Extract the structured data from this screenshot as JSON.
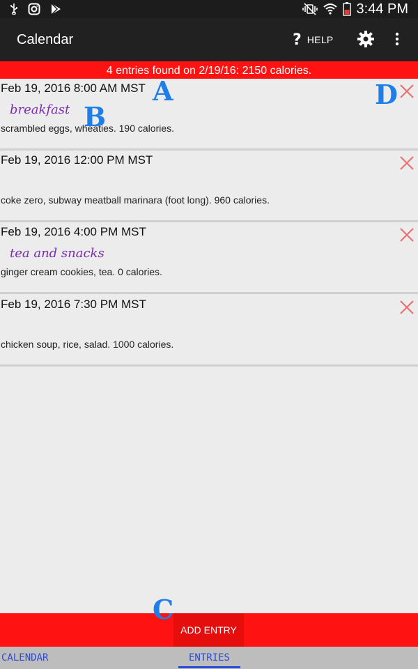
{
  "status_bar": {
    "time": "3:44 PM",
    "icons_left": [
      "usb-icon",
      "instagram-icon",
      "play-store-icon"
    ],
    "icons_right": [
      "vibrate-mute-icon",
      "wifi-icon",
      "battery-icon"
    ]
  },
  "app_bar": {
    "title": "Calendar",
    "help_label": "HELP",
    "help_glyph": "?",
    "icons": [
      "help-icon",
      "settings-gear-icon",
      "overflow-menu-icon"
    ]
  },
  "summary": "4 entries found on 2/19/16: 2150 calories.",
  "entries": [
    {
      "date": "Feb 19, 2016 8:00 AM MST",
      "title": "breakfast",
      "desc": "scrambled eggs, wheaties.  190 calories."
    },
    {
      "date": "Feb 19, 2016 12:00 PM MST",
      "title": "",
      "desc": "coke zero, subway meatball marinara (foot long).  960 calories."
    },
    {
      "date": "Feb 19, 2016 4:00 PM MST",
      "title": "tea and snacks",
      "desc": "ginger cream cookies, tea.  0 calories."
    },
    {
      "date": "Feb 19, 2016 7:30 PM MST",
      "title": "",
      "desc": "chicken soup, rice, salad.  1000 calories."
    }
  ],
  "markers": {
    "a": "A",
    "b": "B",
    "c": "C",
    "d": "D"
  },
  "add_entry_label": "ADD ENTRY",
  "tabs": {
    "calendar": "CALENDAR",
    "entries": "ENTRIES",
    "selected": "entries"
  },
  "colors": {
    "accent_red": "#ff1212",
    "title_purple": "#7b2db0",
    "delete_x": "#e57373",
    "marker_blue": "#1f7ee8",
    "tab_blue": "#2a4bd6"
  }
}
